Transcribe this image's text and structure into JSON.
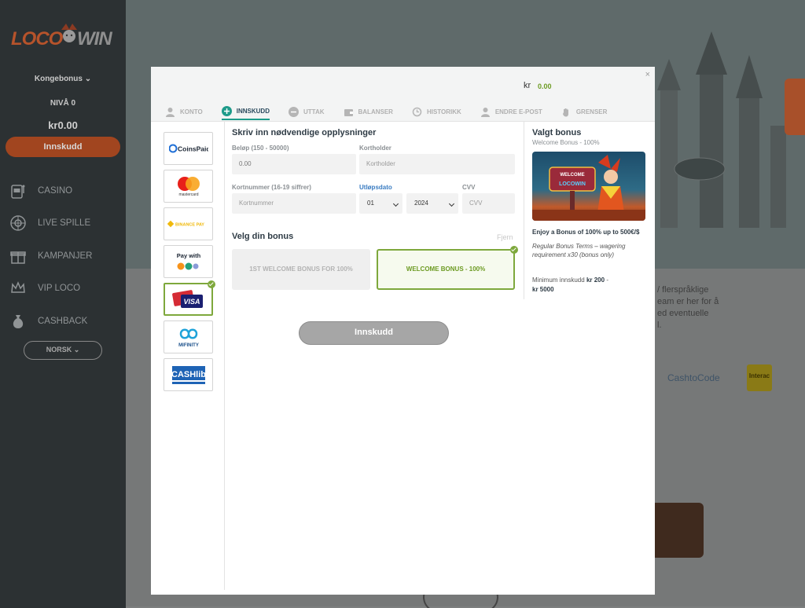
{
  "sidebar": {
    "logo_loco": "LOCO",
    "logo_win": "WIN",
    "bonus_label": "Kongebonus",
    "level": "NIVÅ 0",
    "balance": "kr0.00",
    "deposit_button": "Innskudd",
    "nav": [
      {
        "label": "CASINO",
        "icon": "slot-machine-icon"
      },
      {
        "label": "LIVE SPILLE",
        "icon": "roulette-icon"
      },
      {
        "label": "KAMPANJER",
        "icon": "gift-icon"
      },
      {
        "label": "VIP LOCO",
        "icon": "crown-icon"
      },
      {
        "label": "CASHBACK",
        "icon": "money-bag-icon"
      }
    ],
    "language": "NORSK"
  },
  "background": {
    "text_lines": [
      "/ flerspråklige",
      "eam er her for å",
      "ed eventuelle",
      "l."
    ],
    "cashtocode": "CashtoCode",
    "interac": "Interac"
  },
  "modal": {
    "close": "×",
    "balance_currency": "kr",
    "balance_value": "0.00",
    "tabs": [
      {
        "label": "KONTO",
        "icon": "user-icon",
        "active": false
      },
      {
        "label": "INNSKUDD",
        "icon": "plus-circle-icon",
        "active": true
      },
      {
        "label": "UTTAK",
        "icon": "minus-circle-icon",
        "active": false
      },
      {
        "label": "BALANSER",
        "icon": "wallet-icon",
        "active": false
      },
      {
        "label": "HISTORIKK",
        "icon": "history-icon",
        "active": false
      },
      {
        "label": "ENDRE E-POST",
        "icon": "user-edit-icon",
        "active": false
      },
      {
        "label": "GRENSER",
        "icon": "hand-icon",
        "active": false
      }
    ],
    "payment_methods": [
      {
        "name": "CoinsPaid",
        "selected": false
      },
      {
        "name": "mastercard",
        "selected": false
      },
      {
        "name": "BINANCE PAY",
        "selected": false
      },
      {
        "name": "Pay with",
        "selected": false
      },
      {
        "name": "VISA",
        "selected": true
      },
      {
        "name": "MIFINITY",
        "selected": false
      },
      {
        "name": "CASHlib",
        "selected": false
      }
    ],
    "form": {
      "title": "Skriv inn nødvendige opplysninger",
      "amount_label": "Beløp (150 - 50000)",
      "amount_value": "0.00",
      "cardholder_label": "Kortholder",
      "cardholder_placeholder": "Kortholder",
      "cardnumber_label": "Kortnummer (16-19 siffrer)",
      "cardnumber_placeholder": "Kortnummer",
      "expiry_label": "Utløpsdato",
      "expiry_month": "01",
      "expiry_year": "2024",
      "cvv_label": "CVV",
      "cvv_placeholder": "CVV"
    },
    "bonus": {
      "title": "Velg din bonus",
      "remove": "Fjern",
      "options": [
        {
          "label": "1ST WELCOME BONUS FOR 100%",
          "selected": false
        },
        {
          "label": "WELCOME BONUS - 100%",
          "selected": true
        }
      ]
    },
    "submit": "Innskudd",
    "selected_bonus": {
      "title": "Valgt bonus",
      "subtitle": "Welcome Bonus - 100%",
      "image_text_top": "WELCOME",
      "image_text_bottom": "LOCOWIN",
      "promo": "Enjoy a Bonus of 100% up to 500€/$",
      "terms": "Regular Bonus Terms – wagering requirement x30 (bonus only)",
      "min_label": "Minimum innskudd",
      "min_value": "kr 200",
      "max_value": "kr 5000"
    }
  },
  "colors": {
    "accent_green": "#7ea83c",
    "brand_orange": "#a1451f",
    "tab_active": "#1e9b8a"
  }
}
